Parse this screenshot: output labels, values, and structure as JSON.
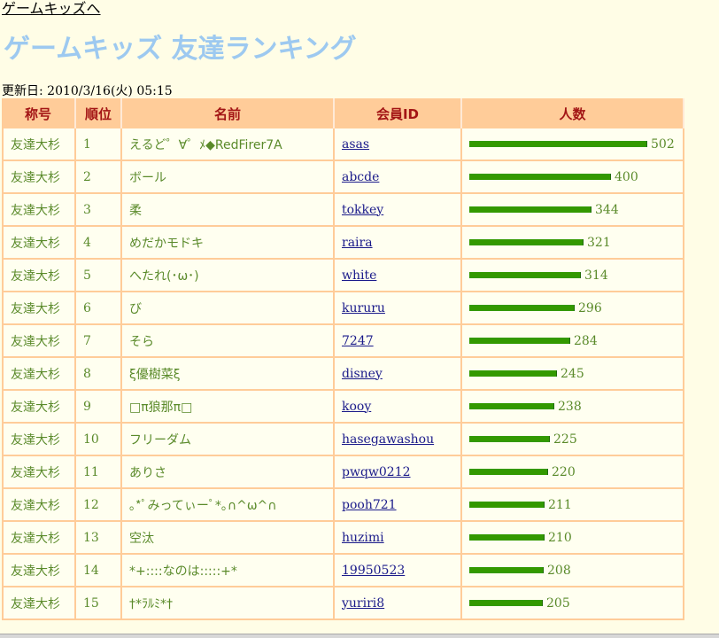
{
  "top_link": "ゲームキッズへ",
  "page_title": "ゲームキッズ 友達ランキング",
  "updated": "更新日: 2010/3/16(火) 05:15",
  "table": {
    "headers": [
      "称号",
      "順位",
      "名前",
      "会員ID",
      "人数"
    ],
    "max_count": 502,
    "rows": [
      {
        "title": "友達大杉",
        "rank": "1",
        "name": "えるど゜∀゜ﾒ◆RedFirer7A",
        "id": "asas",
        "count": 502
      },
      {
        "title": "友達大杉",
        "rank": "2",
        "name": "ボール",
        "id": "abcde",
        "count": 400
      },
      {
        "title": "友達大杉",
        "rank": "3",
        "name": "柔",
        "id": "tokkey",
        "count": 344
      },
      {
        "title": "友達大杉",
        "rank": "4",
        "name": "めだかモドキ",
        "id": "raira",
        "count": 321
      },
      {
        "title": "友達大杉",
        "rank": "5",
        "name": "へたれ(･ω･)",
        "id": "white",
        "count": 314
      },
      {
        "title": "友達大杉",
        "rank": "6",
        "name": "び",
        "id": "kururu",
        "count": 296
      },
      {
        "title": "友達大杉",
        "rank": "7",
        "name": "そら",
        "id": "7247",
        "count": 284
      },
      {
        "title": "友達大杉",
        "rank": "8",
        "name": "ξ優樹菜ξ",
        "id": "disney",
        "count": 245
      },
      {
        "title": "友達大杉",
        "rank": "9",
        "name": "□π狼那π□",
        "id": "kooy",
        "count": 238
      },
      {
        "title": "友達大杉",
        "rank": "10",
        "name": "フリーダム",
        "id": "hasegawashou",
        "count": 225
      },
      {
        "title": "友達大杉",
        "rank": "11",
        "name": "ありさ",
        "id": "pwqw0212",
        "count": 220
      },
      {
        "title": "友達大杉",
        "rank": "12",
        "name": "｡*ﾟみってぃーﾟ*｡∩^ω^∩",
        "id": "pooh721",
        "count": 211
      },
      {
        "title": "友達大杉",
        "rank": "13",
        "name": "空汰",
        "id": "huzimi",
        "count": 210
      },
      {
        "title": "友達大杉",
        "rank": "14",
        "name": "*+::::なのは:::::+*",
        "id": "19950523",
        "count": 208
      },
      {
        "title": "友達大杉",
        "rank": "15",
        "name": "†*ﾗﾙﾐ*†",
        "id": "yuriri8",
        "count": 205
      }
    ]
  }
}
